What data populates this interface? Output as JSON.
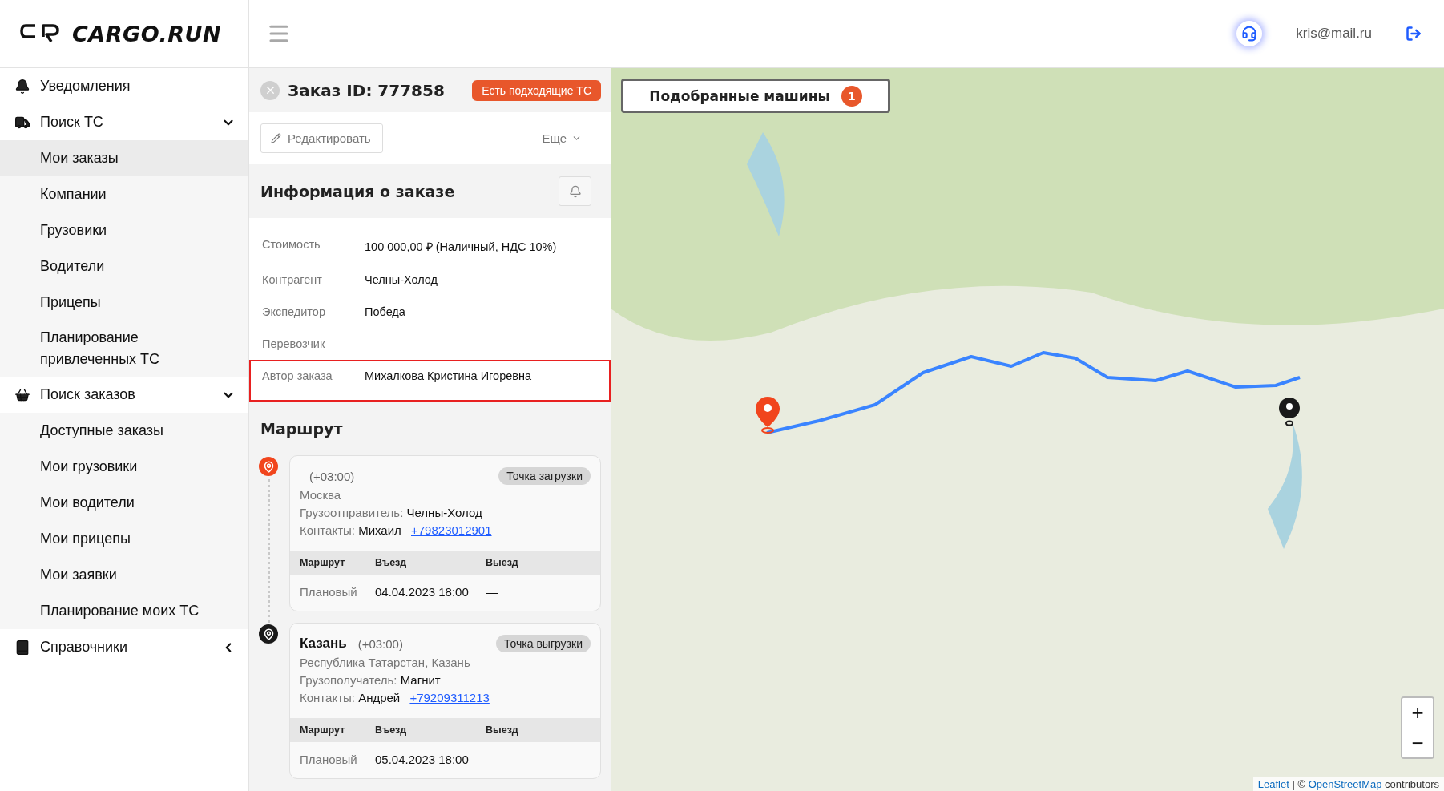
{
  "header": {
    "logo": "CARGO.RUN",
    "user_email": "kris@mail.ru"
  },
  "sidebar": {
    "items": [
      {
        "kind": "bell",
        "label": "Уведомления"
      },
      {
        "kind": "truck",
        "label": "Поиск ТС",
        "expanded": true,
        "children": [
          {
            "label": "Мои заказы",
            "selected": true
          },
          {
            "label": "Компании",
            "selected": false
          },
          {
            "label": "Грузовики",
            "selected": false
          },
          {
            "label": "Водители",
            "selected": false
          },
          {
            "label": "Прицепы",
            "selected": false
          },
          {
            "label": "Планирование привлеченных ТС",
            "selected": false
          }
        ]
      },
      {
        "kind": "basket",
        "label": "Поиск заказов",
        "expanded": true,
        "children": [
          {
            "label": "Доступные заказы",
            "selected": false
          },
          {
            "label": "Мои грузовики",
            "selected": false
          },
          {
            "label": "Мои водители",
            "selected": false
          },
          {
            "label": "Мои прицепы",
            "selected": false
          },
          {
            "label": "Мои заявки",
            "selected": false
          },
          {
            "label": "Планирование моих ТС",
            "selected": false
          }
        ]
      },
      {
        "kind": "book",
        "label": "Справочники",
        "expanded": false
      }
    ]
  },
  "order": {
    "title": "Заказ ID: 777858",
    "badge": "Есть подходящие ТС",
    "edit_button": "Редактировать",
    "more_button": "Еще"
  },
  "info": {
    "title": "Информация о заказе",
    "rows": [
      {
        "label": "Стоимость",
        "value": "100 000,00 ₽ (Наличный, НДС 10%)",
        "highlighted": false
      },
      {
        "label": "Контрагент",
        "value": "Челны-Холод",
        "highlighted": false
      },
      {
        "label": "Экспедитор",
        "value": "Победа",
        "highlighted": false
      },
      {
        "label": "Перевозчик",
        "highlighted": false
      },
      {
        "label": "Автор заказа",
        "value": "Михалкова Кристина Игоревна",
        "highlighted": true
      }
    ]
  },
  "route": {
    "title": "Маршрут",
    "stops": [
      {
        "kind": "loading",
        "timezone": "(+03:00)",
        "badge": "Точка загрузки",
        "address": "Москва",
        "party_label": "Грузоотправитель:",
        "party": "Челны-Холод",
        "contacts_label": "Контакты:",
        "contact_name": "Михаил",
        "phone": "+79823012901",
        "table": {
          "columns": [
            "Маршрут",
            "Въезд",
            "Выезд"
          ],
          "rows": [
            [
              "Плановый",
              "04.04.2023 18:00",
              "—"
            ]
          ]
        }
      },
      {
        "kind": "unloading",
        "city": "Казань",
        "timezone": "(+03:00)",
        "badge": "Точка выгрузки",
        "address": "Республика Татарстан, Казань",
        "party_label": "Грузополучатель:",
        "party": "Магнит",
        "contacts_label": "Контакты:",
        "contact_name": "Андрей",
        "phone": "+79209311213",
        "table": {
          "columns": [
            "Маршрут",
            "Въезд",
            "Выезд"
          ],
          "rows": [
            [
              "Плановый",
              "05.04.2023 18:00",
              "—"
            ]
          ]
        }
      }
    ]
  },
  "map": {
    "matched_button": "Подобранные машины",
    "matched_count": "1",
    "zoom_in": "+",
    "zoom_out": "−",
    "attribution": {
      "leaflet": "Leaflet",
      "separator": "|",
      "copyright": "©",
      "osm": "OpenStreetMap",
      "suffix": "contributors"
    }
  }
}
